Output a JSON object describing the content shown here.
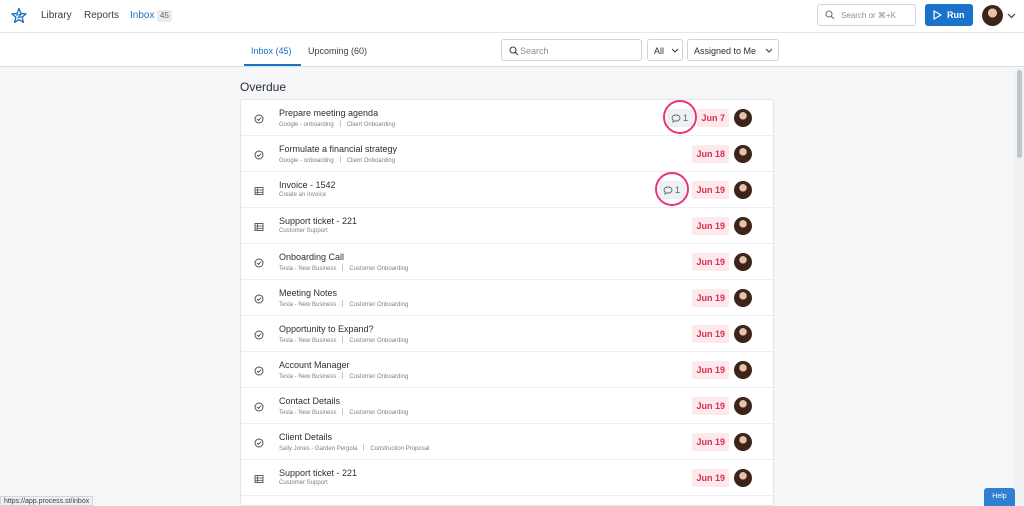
{
  "nav": {
    "library": "Library",
    "reports": "Reports",
    "inbox": "Inbox",
    "inbox_count": "45",
    "search_placeholder": "Search or ⌘+K",
    "run_label": "Run"
  },
  "subnav": {
    "tab_inbox": "Inbox (45)",
    "tab_upcoming": "Upcoming (60)",
    "search_placeholder": "Search",
    "filter_all": "All",
    "filter_assigned": "Assigned to Me"
  },
  "section_title": "Overdue",
  "tasks": [
    {
      "title": "Prepare meeting agenda",
      "sub1": "Google - onboarding",
      "sub2": "Client Onboarding",
      "due": "Jun 7",
      "icon": "check-circle-icon",
      "comments": "1"
    },
    {
      "title": "Formulate a financial strategy",
      "sub1": "Google - onboarding",
      "sub2": "Client Onboarding",
      "due": "Jun 18",
      "icon": "check-circle-icon",
      "comments": ""
    },
    {
      "title": "Invoice - 1542",
      "sub1": "Create an Invoice",
      "sub2": "",
      "due": "Jun 19",
      "icon": "form-icon",
      "comments": "1"
    },
    {
      "title": "Support ticket - 221",
      "sub1": "Customer Support",
      "sub2": "",
      "due": "Jun 19",
      "icon": "form-icon",
      "comments": ""
    },
    {
      "title": "Onboarding Call",
      "sub1": "Tesla - New Business",
      "sub2": "Customer Onboarding",
      "due": "Jun 19",
      "icon": "check-circle-icon",
      "comments": ""
    },
    {
      "title": "Meeting Notes",
      "sub1": "Tesla - New Business",
      "sub2": "Customer Onboarding",
      "due": "Jun 19",
      "icon": "check-circle-icon",
      "comments": ""
    },
    {
      "title": "Opportunity to Expand?",
      "sub1": "Tesla - New Business",
      "sub2": "Customer Onboarding",
      "due": "Jun 19",
      "icon": "check-circle-icon",
      "comments": ""
    },
    {
      "title": "Account Manager",
      "sub1": "Tesla - New Business",
      "sub2": "Customer Onboarding",
      "due": "Jun 19",
      "icon": "check-circle-icon",
      "comments": ""
    },
    {
      "title": "Contact Details",
      "sub1": "Tesla - New Business",
      "sub2": "Customer Onboarding",
      "due": "Jun 19",
      "icon": "check-circle-icon",
      "comments": ""
    },
    {
      "title": "Client Details",
      "sub1": "Sally Jones - Garden Pergola",
      "sub2": "Construction Proposal",
      "due": "Jun 19",
      "icon": "check-circle-icon",
      "comments": ""
    },
    {
      "title": "Support ticket - 221",
      "sub1": "Customer Support",
      "sub2": "",
      "due": "Jun 19",
      "icon": "form-icon",
      "comments": ""
    }
  ],
  "status_url": "https://app.process.st/inbox",
  "help_label": "Help",
  "colors": {
    "accent": "#1a73c8",
    "overdue_bg": "#fde8ec",
    "overdue_text": "#d6304e",
    "annotation_ring": "#e8357a"
  }
}
